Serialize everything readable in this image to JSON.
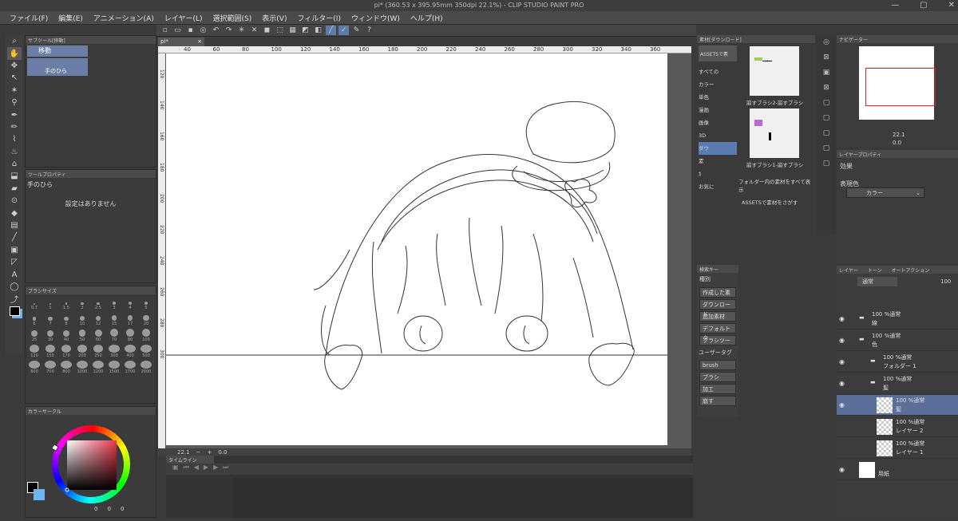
{
  "window": {
    "title": "pi* (360.53 x 395.95mm 350dpi 22.1%) - CLIP STUDIO PAINT PRO",
    "min": "—",
    "max": "▢",
    "close": "✕"
  },
  "menu": [
    "ファイル(F)",
    "編集(E)",
    "アニメーション(A)",
    "レイヤー(L)",
    "選択範囲(S)",
    "表示(V)",
    "フィルター(I)",
    "ウィンドウ(W)",
    "ヘルプ(H)"
  ],
  "subtool": {
    "header": "サブツール[移動]",
    "group": "移動",
    "item": "手のひら"
  },
  "toolprop": {
    "header": "ツールプロパティ",
    "name": "手のひら",
    "empty": "設定はありません"
  },
  "brushsize": {
    "header": "ブラシサイズ",
    "sizes": [
      "0.7",
      "1",
      "1.5",
      "2",
      "2.5",
      "3",
      "4",
      "5",
      "6",
      "7",
      "8",
      "10",
      "12",
      "15",
      "17",
      "20",
      "25",
      "30",
      "40",
      "50",
      "60",
      "70",
      "80",
      "100",
      "120",
      "150",
      "170",
      "200",
      "250",
      "300",
      "400",
      "500",
      "600",
      "700",
      "800",
      "1000",
      "1200",
      "1500",
      "1700",
      "2000"
    ]
  },
  "colorcircle": {
    "header": "カラーサークル",
    "hue_marker_color": "#e8364c",
    "main_color": "#000000",
    "sub_color": "#6fb6f0",
    "readout": [
      "0",
      "0",
      "0"
    ]
  },
  "canvas": {
    "tab": "pi*",
    "ruler": [
      "40",
      "60",
      "80",
      "100",
      "120",
      "140",
      "160",
      "180",
      "200",
      "220",
      "240",
      "260",
      "280",
      "300",
      "320",
      "340",
      "360"
    ],
    "vruler": [
      "120",
      "140",
      "160",
      "180",
      "200",
      "220",
      "240",
      "260",
      "280",
      "300"
    ]
  },
  "status": {
    "zoom": "22.1",
    "rotate": "0.0"
  },
  "timeline": {
    "header": "タイムライン"
  },
  "materials": {
    "header": "素材[ダウンロード]",
    "assets": "ASSETSで素",
    "tree": [
      "すべての",
      "カラー",
      "単色",
      "漫画",
      "画像",
      "3D",
      "ダウ",
      "素",
      "ｶ",
      "お気に"
    ],
    "items": [
      "崩すブラシ2-崩すブラシ",
      "崩すブラシ1-崩すブラシ"
    ],
    "folder_note": "フォルダー内の素材をすべて表示",
    "assets_search": "ASSETSで素材をさがす"
  },
  "search": {
    "header": "検索キー",
    "type_label": "種別",
    "buttons": [
      "作成した素",
      "ダウンロード",
      "追加素材",
      "デフォルトタ",
      "ブラシツー"
    ],
    "user_tag": "ユーザータグ",
    "tags": [
      "brush",
      "ブラシ",
      "加工",
      "崩す"
    ]
  },
  "navigator": {
    "header": "ナビゲーター",
    "zoom": "22.1",
    "rotate": "0.0"
  },
  "layerprop": {
    "header": "レイヤープロパティ",
    "effect": "効果",
    "expression": "表現色",
    "color": "カラー"
  },
  "layers": {
    "tabs": [
      "レイヤー",
      "トーン",
      "オートアクション"
    ],
    "blend": "通常",
    "opacity": "100",
    "rows": [
      {
        "mode": "100 %通常",
        "name": "線"
      },
      {
        "mode": "100 %通常",
        "name": "色"
      },
      {
        "mode": "100 %通常",
        "name": "フォルダー 1"
      },
      {
        "mode": "100 %通常",
        "name": "髪"
      },
      {
        "mode": "100 %通常",
        "name": "髪"
      },
      {
        "mode": "100 %通常",
        "name": "レイヤー 2"
      },
      {
        "mode": "100 %通常",
        "name": "レイヤー 1"
      },
      {
        "mode": "",
        "name": "用紙"
      }
    ]
  }
}
